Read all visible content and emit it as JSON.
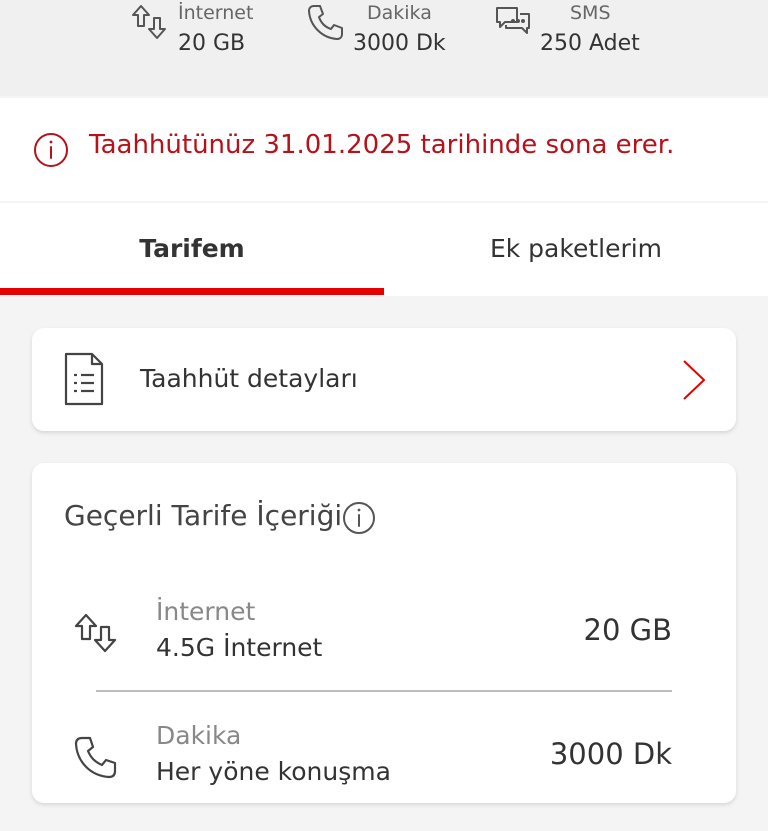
{
  "summary": {
    "items": [
      {
        "label": "İnternet",
        "value": "20 GB",
        "icon": "data-transfer-icon"
      },
      {
        "label": "Dakika",
        "value": "3000 Dk",
        "icon": "phone-icon"
      },
      {
        "label": "SMS",
        "value": "250 Adet",
        "icon": "chat-icon"
      }
    ]
  },
  "alert": {
    "text": "Taahhütünüz 31.01.2025 tarihinde sona erer.",
    "icon": "info-circle-icon",
    "color": "#b5121b"
  },
  "tabs": [
    {
      "label": "Tarifem",
      "active": true
    },
    {
      "label": "Ek paketlerim",
      "active": false
    }
  ],
  "accent_color": "#e60000",
  "commitment_card": {
    "label": "Taahhüt detayları",
    "icon": "document-icon",
    "chevron": "chevron-right-icon"
  },
  "tariff": {
    "title": "Geçerli Tarife İçeriği",
    "rows": [
      {
        "label": "İnternet",
        "sub": "4.5G İnternet",
        "value": "20 GB",
        "icon": "data-transfer-icon"
      },
      {
        "label": "Dakika",
        "sub": "Her yöne konuşma",
        "value": "3000 Dk",
        "icon": "phone-icon"
      }
    ]
  }
}
